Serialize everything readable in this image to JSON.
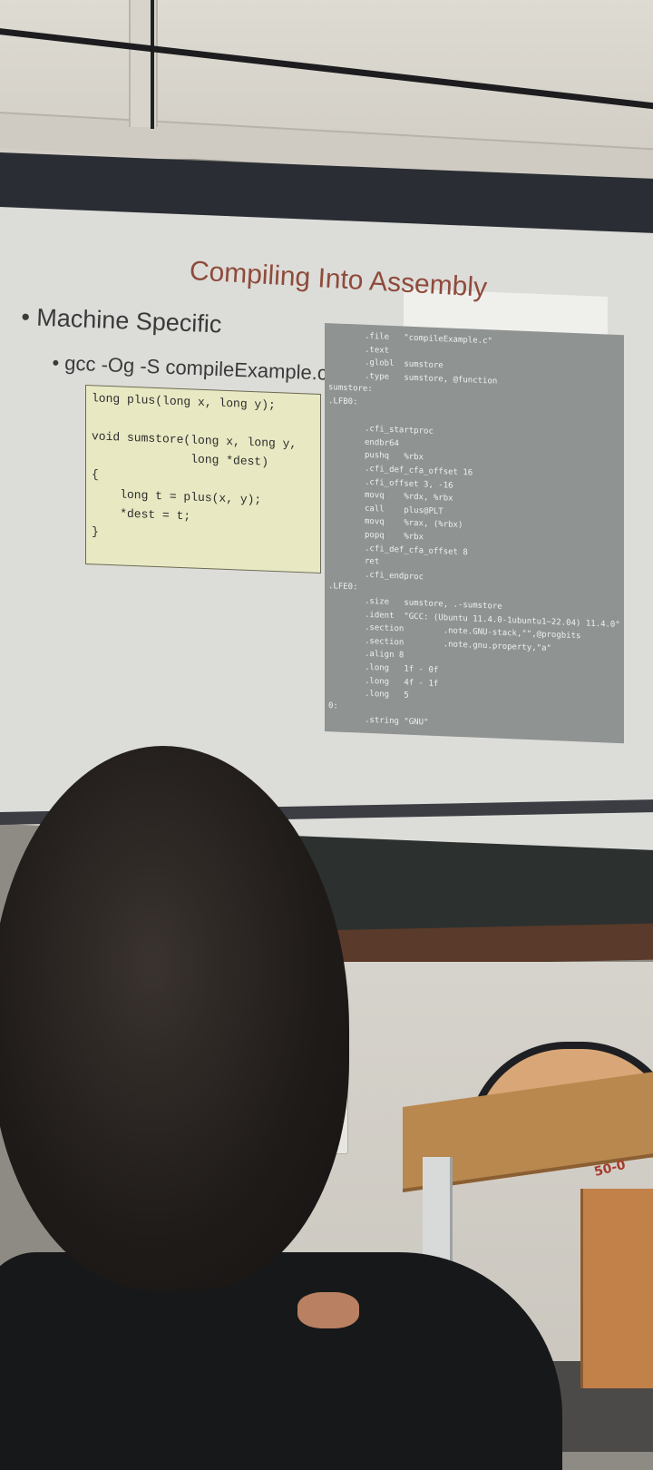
{
  "slide": {
    "title": "Compiling Into Assembly",
    "bullet1": "• Machine Specific",
    "bullet2": "• gcc -Og -S compileExample.c"
  },
  "c_code": [
    "long plus(long x, long y);",
    "",
    "void sumstore(long x, long y,",
    "              long *dest)",
    "{",
    "    long t = plus(x, y);",
    "    *dest = t;",
    "}"
  ],
  "asm_code": [
    {
      "indent": 1,
      "text": ".file   \"compileExample.c\""
    },
    {
      "indent": 1,
      "text": ".text"
    },
    {
      "indent": 1,
      "text": ".globl  sumstore"
    },
    {
      "indent": 1,
      "text": ".type   sumstore, @function"
    },
    {
      "indent": 0,
      "text": "sumstore:"
    },
    {
      "indent": 0,
      "text": ".LFB0:"
    },
    {
      "indent": 1,
      "text": ""
    },
    {
      "indent": 1,
      "text": ".cfi_startproc"
    },
    {
      "indent": 1,
      "text": "endbr64"
    },
    {
      "indent": 1,
      "text": "pushq   %rbx"
    },
    {
      "indent": 1,
      "text": ".cfi_def_cfa_offset 16"
    },
    {
      "indent": 1,
      "text": ".cfi_offset 3, -16"
    },
    {
      "indent": 1,
      "text": "movq    %rdx, %rbx"
    },
    {
      "indent": 1,
      "text": "call    plus@PLT"
    },
    {
      "indent": 1,
      "text": "movq    %rax, (%rbx)"
    },
    {
      "indent": 1,
      "text": "popq    %rbx"
    },
    {
      "indent": 1,
      "text": ".cfi_def_cfa_offset 8"
    },
    {
      "indent": 1,
      "text": "ret"
    },
    {
      "indent": 1,
      "text": ".cfi_endproc"
    },
    {
      "indent": 0,
      "text": ".LFE0:"
    },
    {
      "indent": 1,
      "text": ".size   sumstore, .-sumstore"
    },
    {
      "indent": 1,
      "text": ".ident  \"GCC: (Ubuntu 11.4.0-1ubuntu1~22.04) 11.4.0\""
    },
    {
      "indent": 1,
      "text": ".section        .note.GNU-stack,\"\",@progbits"
    },
    {
      "indent": 1,
      "text": ".section        .note.gnu.property,\"a\""
    },
    {
      "indent": 1,
      "text": ".align 8"
    },
    {
      "indent": 1,
      "text": ".long   1f - 0f"
    },
    {
      "indent": 1,
      "text": ".long   4f - 1f"
    },
    {
      "indent": 1,
      "text": ".long   5"
    },
    {
      "indent": 0,
      "text": "0:"
    },
    {
      "indent": 1,
      "text": ".string \"GNU\""
    }
  ],
  "desk_label": "50-0",
  "colors": {
    "title": "#8f4a3b",
    "code_box": "#e8e9c3",
    "asm_box": "#8f9392",
    "desk": "#b9884f"
  }
}
